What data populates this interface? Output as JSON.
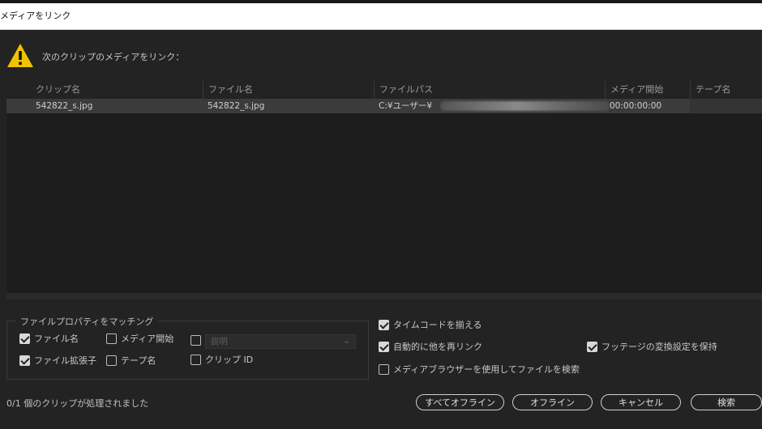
{
  "window": {
    "title": "メディアをリンク"
  },
  "prompt": "次のクリップのメディアをリンク：",
  "icons": {
    "warning": "warning-triangle-icon",
    "dropdown": "chevron-down-icon"
  },
  "table": {
    "columns": [
      "クリップ名",
      "ファイル名",
      "ファイルパス",
      "メディア開始",
      "テープ名"
    ],
    "rows": [
      {
        "clip_name": "542822_s.jpg",
        "file_name": "542822_s.jpg",
        "file_path": "C:¥ユーザー¥",
        "media_start": "00:00:00:00",
        "tape_name": ""
      }
    ]
  },
  "match_group": {
    "legend": "ファイルプロパティをマッチング",
    "file_name": {
      "label": "ファイル名",
      "checked": true
    },
    "media_start": {
      "label": "メディア開始",
      "checked": false
    },
    "description": {
      "label": "説明",
      "checked": false,
      "disabled": true
    },
    "file_ext": {
      "label": "ファイル拡張子",
      "checked": true
    },
    "tape_name": {
      "label": "テープ名",
      "checked": false
    },
    "clip_id": {
      "label": "クリップ ID",
      "checked": false
    }
  },
  "options": {
    "align_timecode": {
      "label": "タイムコードを揃える",
      "checked": true
    },
    "auto_relink": {
      "label": "自動的に他を再リンク",
      "checked": true
    },
    "preserve_interpret": {
      "label": "フッテージの変換設定を保持",
      "checked": true
    },
    "use_media_browser": {
      "label": "メディアブラウザーを使用してファイルを検索",
      "checked": false
    }
  },
  "status": "0/1 個のクリップが処理されました",
  "buttons": {
    "offline_all": "すべてオフライン",
    "offline": "オフライン",
    "cancel": "キャンセル",
    "search": "検索"
  },
  "colors": {
    "background": "#232323",
    "table_bg": "#1d1d1d",
    "selected_row": "#3b3b3b",
    "warning": "#f2c200"
  }
}
